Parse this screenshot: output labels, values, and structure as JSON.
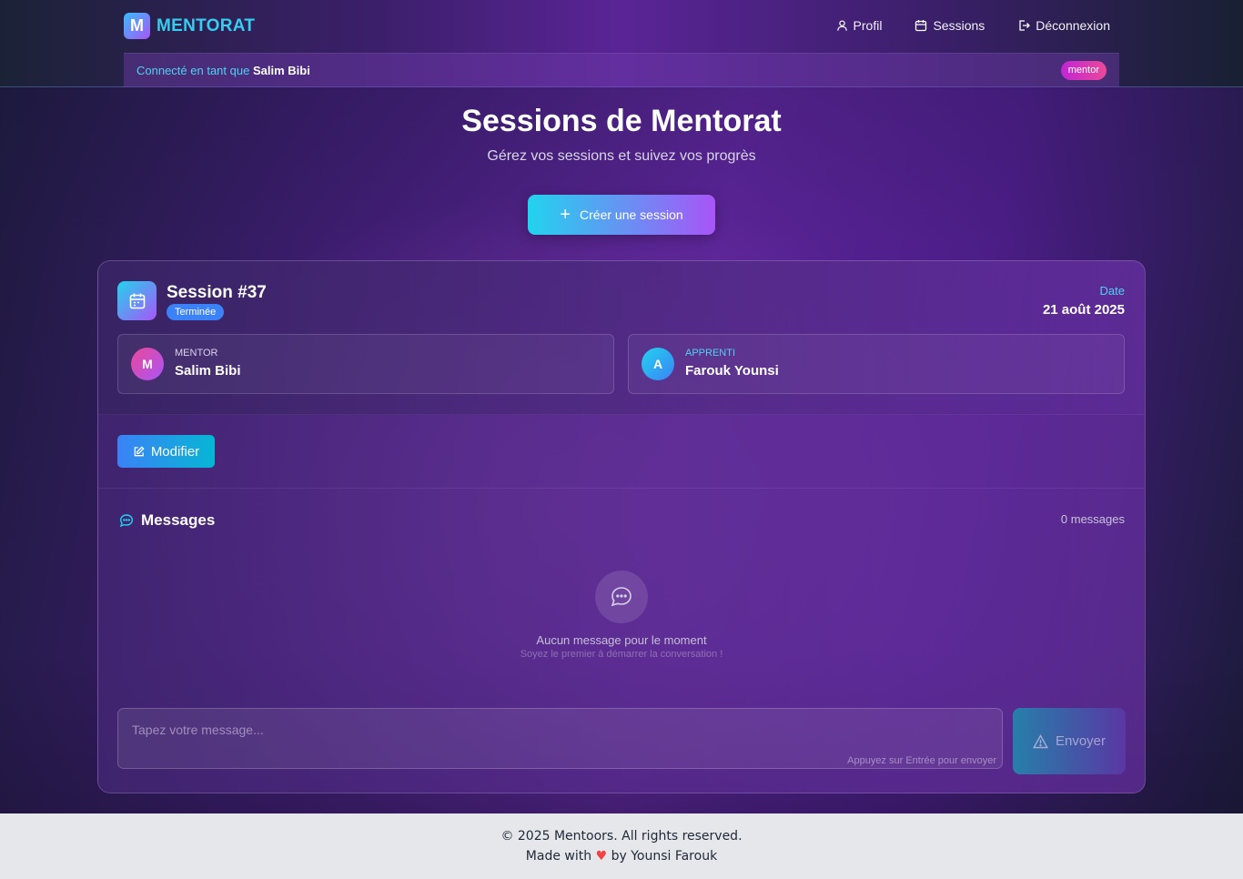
{
  "header": {
    "logo_letter": "M",
    "logo_text": "MENTORAT",
    "nav": [
      {
        "label": "Profil",
        "icon": "user-icon"
      },
      {
        "label": "Sessions",
        "icon": "calendar-icon"
      },
      {
        "label": "Déconnexion",
        "icon": "logout-icon"
      }
    ],
    "userbar": {
      "prefix": "Connecté en tant que",
      "username": "Salim Bibi",
      "role": "mentor"
    }
  },
  "hero": {
    "title": "Sessions de Mentorat",
    "subtitle": "Gérez vos sessions et suivez vos progrès",
    "create_button": "Créer une session"
  },
  "session": {
    "title": "Session #37",
    "status": "Terminée",
    "date_label": "Date",
    "date_value": "21 août 2025",
    "mentor": {
      "role": "MENTOR",
      "name": "Salim Bibi",
      "initial": "M"
    },
    "apprentice": {
      "role": "APPRENTI",
      "name": "Farouk Younsi",
      "initial": "A"
    },
    "edit_button": "Modifier"
  },
  "messages": {
    "title": "Messages",
    "count": "0 messages",
    "empty_title": "Aucun message pour le moment",
    "empty_subtitle": "Soyez le premier à démarrer la conversation !",
    "input_placeholder": "Tapez votre message...",
    "input_hint": "Appuyez sur Entrée pour envoyer",
    "send_button": "Envoyer"
  },
  "footer": {
    "line1": "© 2025 Mentoors. All rights reserved.",
    "line2_prefix": "Made with",
    "line2_suffix": "by Younsi Farouk"
  },
  "colors": {
    "accent_cyan": "#22d3ee",
    "accent_purple": "#a855f7",
    "status_blue": "#3b82f6",
    "role_pink": "#ec4899"
  }
}
